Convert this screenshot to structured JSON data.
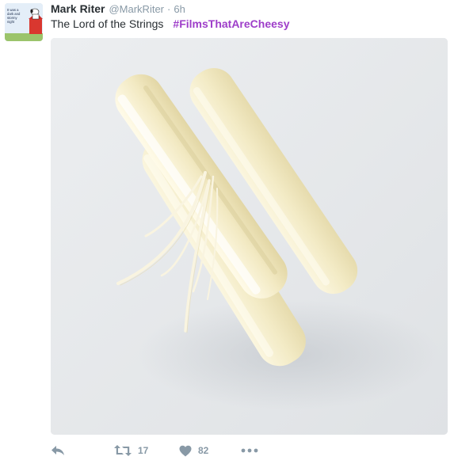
{
  "tweet": {
    "fullname": "Mark Riter",
    "username": "@MarkRiter",
    "separator": "·",
    "time": "6h",
    "text": "The Lord of the Strings",
    "hashtag": "#FilmsThatAreCheesy"
  },
  "avatar": {
    "caption_lines": [
      "It was a",
      "dark and",
      "stormy",
      "night"
    ]
  },
  "actions": {
    "retweet_count": "17",
    "like_count": "82"
  },
  "colors": {
    "hashtag": "#9e3ec9",
    "muted": "#8899a6",
    "text": "#292f33"
  },
  "icons": [
    "reply-icon",
    "retweet-icon",
    "heart-icon",
    "more-icon"
  ]
}
